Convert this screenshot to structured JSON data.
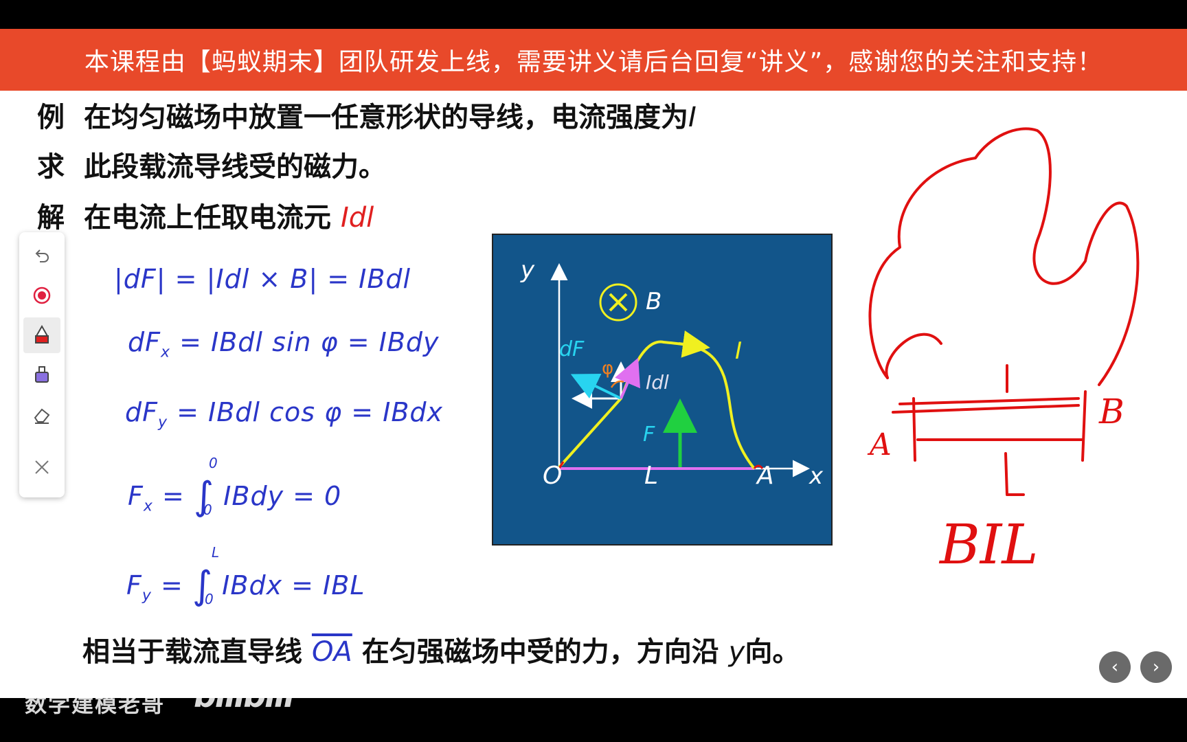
{
  "banner": {
    "text": "本课程由【蚂蚁期末】团队研发上线，需要讲义请后台回复“讲义”，感谢您的关注和支持！"
  },
  "problem": {
    "example_label": "例",
    "example_text": "在均匀磁场中放置一任意形状的导线，电流强度为",
    "example_var": "I",
    "ask_label": "求",
    "ask_text": "此段载流导线受的磁力。",
    "solve_label": "解",
    "solve_text": "在电流上任取电流元",
    "solve_var": "Idl"
  },
  "equations": {
    "eq1": "|dF| = |Idl × B| = IBdl",
    "eq2": {
      "lhs": "dF",
      "sub": "x",
      "rhs": "= IBdl sin φ = IBdy"
    },
    "eq3": {
      "lhs": "dF",
      "sub": "y",
      "rhs": "= IBdl cos φ = IBdx"
    },
    "eq4": {
      "lhs": "F",
      "sub": "x",
      "upper": "0",
      "lower": "0",
      "rhs": "IBdy = 0"
    },
    "eq5": {
      "lhs": "F",
      "sub": "y",
      "upper": "L",
      "lower": "0",
      "rhs": "IBdx = IBL"
    }
  },
  "conclusion": {
    "part1": "相当于载流直导线",
    "segment": "OA",
    "part2": "在匀强磁场中受的力，方向沿",
    "var": "y",
    "part3": "向。"
  },
  "figure": {
    "y_axis": "y",
    "x_axis": "x",
    "origin": "O",
    "length": "L",
    "point_a": "A",
    "field": "B",
    "force_elem": "dF",
    "angle": "φ",
    "current_elem": "Idl",
    "current": "I",
    "force": "F"
  },
  "annotation": {
    "left_label": "A",
    "right_label": "B",
    "mid_label": "L",
    "formula": "BIL"
  },
  "toolbar": {
    "tools": [
      "undo-icon",
      "laser-pointer-icon",
      "red-pen-icon",
      "purple-highlighter-icon",
      "eraser-icon",
      "close-icon"
    ]
  },
  "nav": {
    "prev": "‹",
    "next": "›"
  },
  "watermark": {
    "channel": "数学建模老哥",
    "logo": "bilibili"
  },
  "colors": {
    "banner": "#e8492a",
    "equation": "#2a36c8",
    "figure_bg": "#12558a",
    "annotation": "#e01010"
  }
}
